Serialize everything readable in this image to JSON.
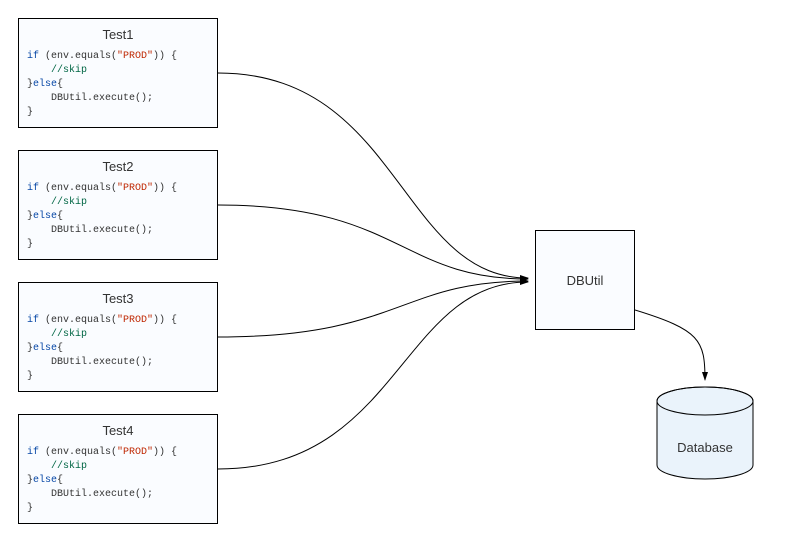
{
  "tests": [
    {
      "title": "Test1"
    },
    {
      "title": "Test2"
    },
    {
      "title": "Test3"
    },
    {
      "title": "Test4"
    }
  ],
  "code": {
    "line1_pre": "if",
    "line1_mid": " (env.equals(",
    "line1_str": "\"PROD\"",
    "line1_post": ")) {",
    "line2": "//skip",
    "line3_pre": "}",
    "line3_kw": "else",
    "line3_post": "{",
    "line4": "    DBUtil.execute();",
    "line5": "}"
  },
  "dbutil": {
    "label": "DBUtil"
  },
  "database": {
    "label": "Database"
  },
  "colors": {
    "box_fill": "#fafcff",
    "box_stroke": "#000000",
    "db_fill": "#eaf3fb"
  }
}
